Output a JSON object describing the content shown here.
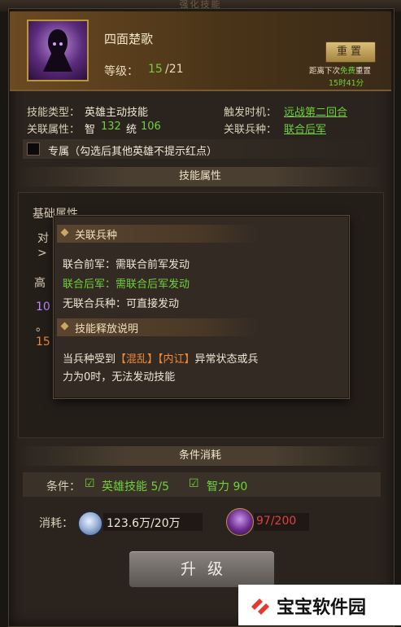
{
  "top_strip": "强化技能",
  "header": {
    "skill_name": "四面楚歌",
    "level_label": "等级：",
    "level_current": "15",
    "level_max": "/21",
    "reset_button": "重置",
    "reset_note_prefix": "距离下次",
    "reset_note_free": "免费",
    "reset_note_suffix": "重置",
    "reset_time": "15时41分"
  },
  "info": {
    "type_label": "技能类型：",
    "type_value": "英雄主动技能",
    "trigger_label": "触发时机：",
    "trigger_value": "远战第二回合",
    "attr_label": "关联属性：",
    "attr_int": "智",
    "attr_int_value": "132",
    "attr_lead": "统",
    "attr_lead_value": "106",
    "troop_label": "关联兵种：",
    "troop_value": "联合后军"
  },
  "exclusive_checkbox": {
    "label": "专属（勾选后其他英雄不提示红点）",
    "checked": false
  },
  "skill_attr_title": "技能属性",
  "background_fragments": {
    "basic_attr": "基础属性",
    "line1": "对",
    "line2": ">",
    "high": "高",
    "num1": "10",
    "dot": "。",
    "num2": "15"
  },
  "popup": {
    "section1_title": "关联兵种",
    "line1": "联合前军：需联合前军发动",
    "line2": "联合后军：需联合后军发动",
    "line3": "无联合兵种：可直接发动",
    "section2_title": "技能释放说明",
    "desc_prefix": "当兵种受到",
    "tag1": "【混乱】",
    "tag2": "【内讧】",
    "desc_suffix": "异常状态或兵",
    "desc_line2": "力为0时，无法发动技能"
  },
  "conditions": {
    "title": "条件消耗",
    "label": "条件：",
    "cond1": "英雄技能 5/5",
    "cond2": "智力 90"
  },
  "cost": {
    "label": "消耗：",
    "silver": "123.6万/20万",
    "book": "97/200"
  },
  "upgrade_button": "升级",
  "watermark": "宝宝软件园",
  "colors": {
    "green": "#6fd23a",
    "orange": "#f08a3a",
    "red": "#e04040",
    "gold": "#b9953c"
  }
}
